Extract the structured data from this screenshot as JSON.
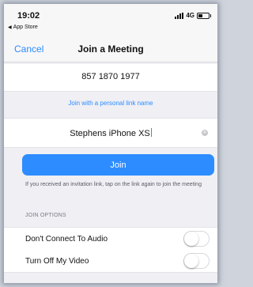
{
  "status_bar": {
    "time": "19:02",
    "back_app": "App Store",
    "network": "4G"
  },
  "nav": {
    "cancel_label": "Cancel",
    "title": "Join a Meeting"
  },
  "form": {
    "meeting_id": "857 1870 1977",
    "personal_link_label": "Join with a personal link name",
    "display_name": "Stephens iPhone XS",
    "join_label": "Join",
    "hint": "If you received an invitation link, tap on the link again to join the meeting"
  },
  "join_options": {
    "header": "JOIN OPTIONS",
    "items": [
      {
        "label": "Don't Connect To Audio",
        "enabled": false
      },
      {
        "label": "Turn Off My Video",
        "enabled": false
      }
    ]
  },
  "icons": {
    "clear": "clear-input-icon",
    "signal": "signal-bars-icon",
    "battery": "battery-icon",
    "back": "back-triangle-icon"
  },
  "colors": {
    "accent": "#2d8cff",
    "background": "#efeff4"
  }
}
